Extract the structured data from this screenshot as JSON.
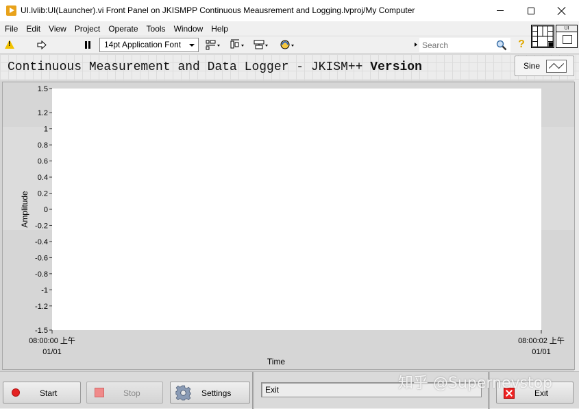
{
  "window": {
    "title": "UI.lvlib:UI(Launcher).vi Front Panel on JKISMPP Continuous Meausrement and Logging.lvproj/My Computer"
  },
  "menu": [
    "File",
    "Edit",
    "View",
    "Project",
    "Operate",
    "Tools",
    "Window",
    "Help"
  ],
  "toolbar": {
    "font_select": "14pt Application Font",
    "search_placeholder": "Search"
  },
  "vi_icon_label": "UI",
  "panel": {
    "title_prefix": "Continuous Measurement and Data Logger - JKISM++ ",
    "title_bold": "Version",
    "signal_type": "Sine"
  },
  "chart_data": {
    "type": "line",
    "ylabel": "Amplitude",
    "xlabel": "Time",
    "ylim": [
      -1.5,
      1.5
    ],
    "y_ticks": [
      "1.5",
      "1.2",
      "1",
      "0.8",
      "0.6",
      "0.4",
      "0.2",
      "0",
      "-0.2",
      "-0.4",
      "-0.6",
      "-0.8",
      "-1",
      "-1.2",
      "-1.5"
    ],
    "y_tick_values": [
      1.5,
      1.2,
      1,
      0.8,
      0.6,
      0.4,
      0.2,
      0,
      -0.2,
      -0.4,
      -0.6,
      -0.8,
      -1,
      -1.2,
      -1.5
    ],
    "x_ticks": [
      {
        "time": "08:00:00 上午",
        "date": "01/01"
      },
      {
        "time": "08:00:02 上午",
        "date": "01/01"
      }
    ],
    "series": []
  },
  "buttons": {
    "start": "Start",
    "stop": "Stop",
    "settings": "Settings",
    "exit": "Exit"
  },
  "status_text": "Exit",
  "watermark": "知乎 @Supernevstop",
  "colors": {
    "plot_bg": "#ffffff",
    "panel_bg": "#d4d4d4",
    "start_red": "#e52222",
    "warning_yellow": "#f2c200"
  }
}
